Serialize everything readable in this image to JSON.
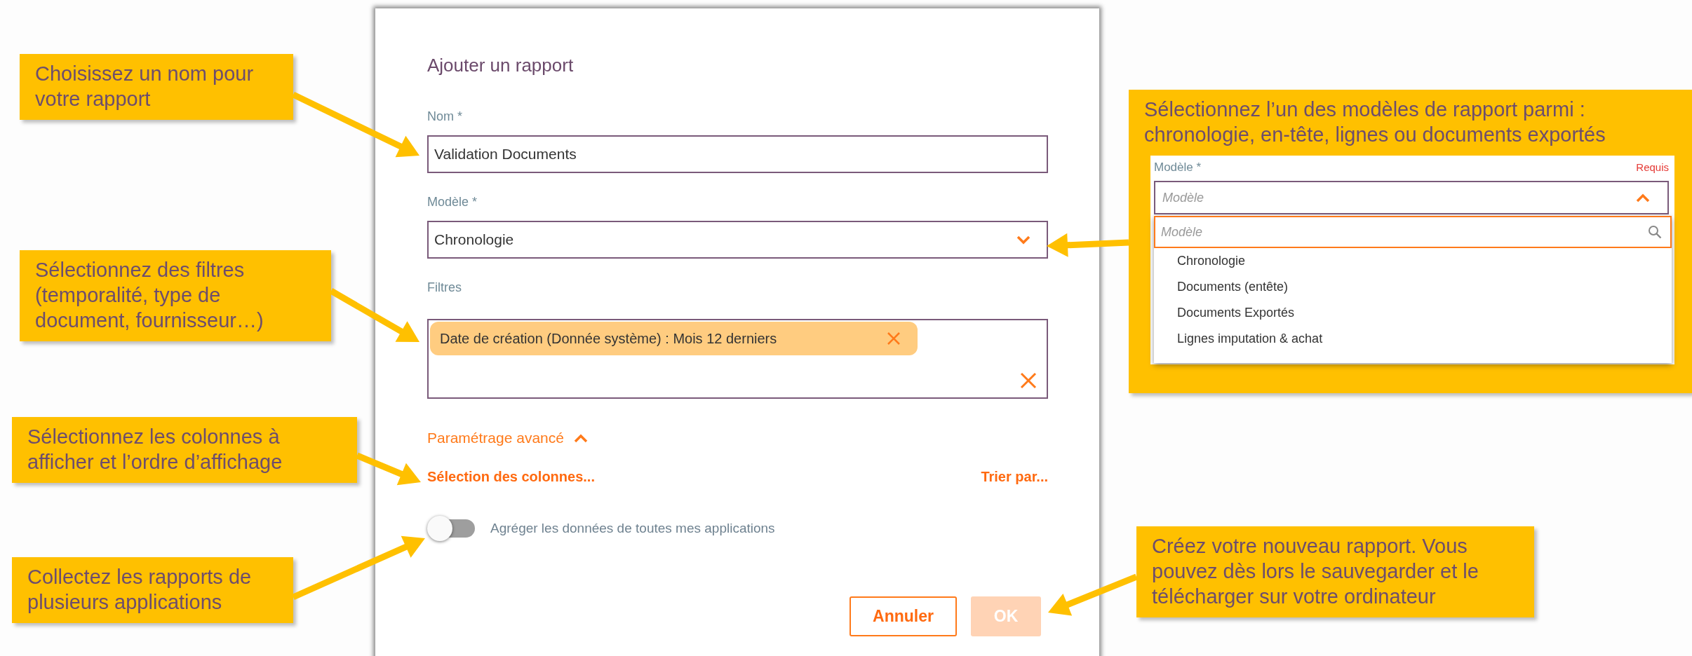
{
  "dialog": {
    "title": "Ajouter un rapport",
    "fields": [
      {
        "kind": "text",
        "label": "Nom *",
        "value": "Validation Documents"
      },
      {
        "kind": "select",
        "label": "Modèle *",
        "value": "Chronologie",
        "expanded": false
      },
      {
        "kind": "filters",
        "label": "Filtres",
        "chips": [
          {
            "text": "Date de création (Donnée système) : Mois 12 derniers"
          }
        ]
      }
    ],
    "advanced": {
      "label": "Paramétrage avancé",
      "expanded": true,
      "links": [
        "Sélection des colonnes...",
        "Trier par..."
      ]
    },
    "toggle": {
      "label": "Agréger les données de toutes mes applications",
      "on": false
    },
    "buttons": [
      {
        "label": "Annuler",
        "kind": "secondary",
        "disabled": false
      },
      {
        "label": "OK",
        "kind": "primary",
        "disabled": true
      }
    ]
  },
  "callouts": [
    {
      "text": "Choisissez un nom pour votre rapport"
    },
    {
      "text": "Sélectionnez des filtres (temporalité, type de document, fournisseur…)"
    },
    {
      "text": "Sélectionnez les colonnes à afficher et l’ordre d’affichage"
    },
    {
      "text": "Collectez les rapports de plusieurs applications"
    },
    {
      "text": "Sélectionnez l’un des modèles de rapport parmi : chronologie, en-tête, lignes ou documents exportés"
    },
    {
      "text": "Créez votre nouveau rapport. Vous pouvez dès lors le sauvegarder et le télécharger sur votre ordinateur"
    }
  ],
  "inset": {
    "label": "Modèle *",
    "hint": "Requis",
    "placeholder": "Modèle",
    "expanded": true,
    "search_placeholder": "Modèle",
    "options": [
      "Chronologie",
      "Documents (entête)",
      "Documents Exportés",
      "Lignes imputation & achat"
    ]
  }
}
